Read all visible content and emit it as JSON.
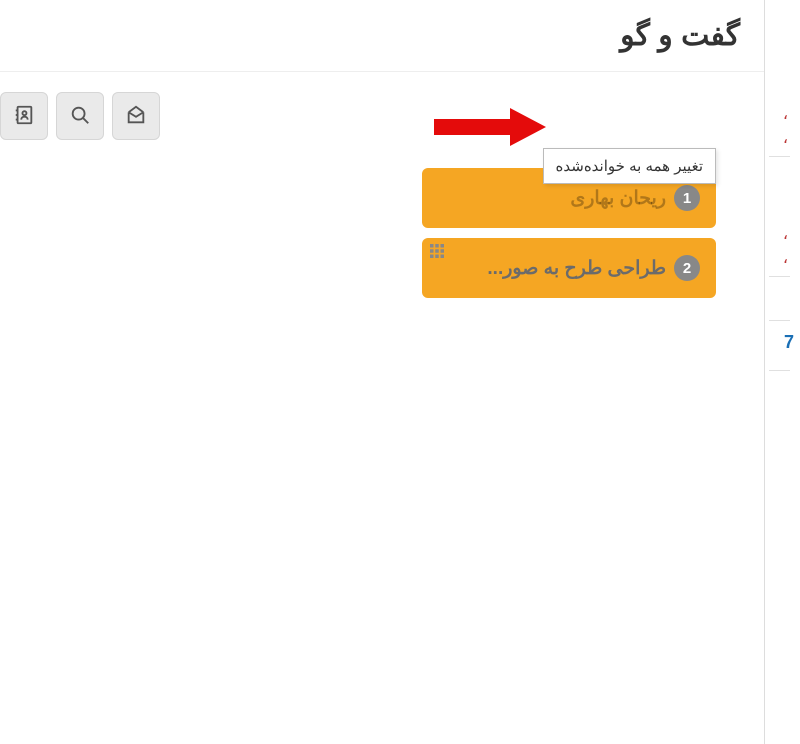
{
  "header": {
    "title": "گفت و گو"
  },
  "toolbar": {
    "tooltip_mark_read": "تغییر همه به خوانده‌شده"
  },
  "conversations": [
    {
      "title": "ریحان بهاری",
      "badge": "1"
    },
    {
      "title": "طراحی طرح به صور...",
      "badge": "2"
    }
  ],
  "sliver": {
    "num": "7"
  },
  "colors": {
    "arrow": "#e40b0b",
    "card": "#f5a623",
    "badge": "#888"
  }
}
